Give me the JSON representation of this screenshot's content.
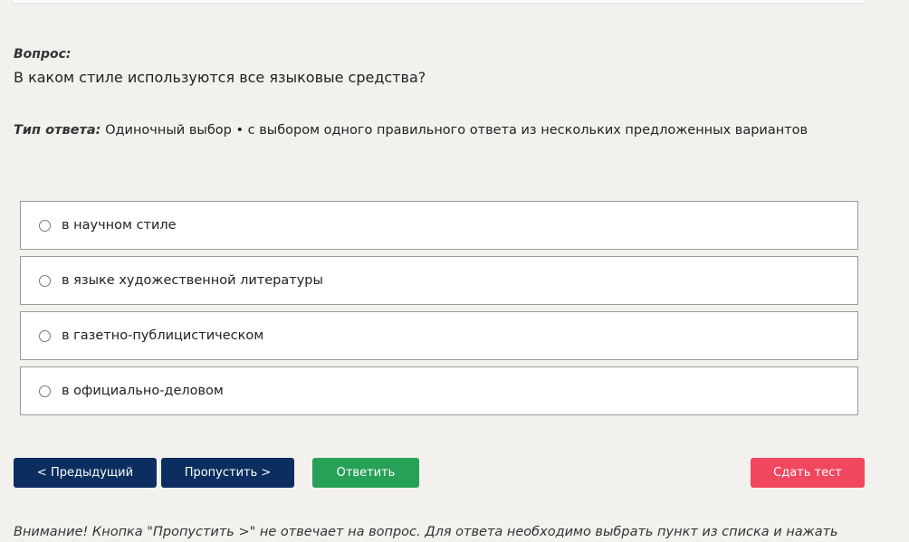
{
  "question": {
    "label": "Вопрос:",
    "text": "В каком стиле используются все языковые средства?"
  },
  "answer_type": {
    "label": "Тип ответа:",
    "value": "Одиночный выбор • с выбором одного правильного ответа из нескольких предложенных вариантов"
  },
  "options": [
    {
      "label": "в научном стиле",
      "selected": false
    },
    {
      "label": "в языке художественной литературы",
      "selected": false
    },
    {
      "label": "в газетно-публицистическом",
      "selected": false
    },
    {
      "label": "в официально-деловом",
      "selected": false
    }
  ],
  "buttons": {
    "prev": "< Предыдущий",
    "skip": "Пропустить >",
    "answer": "Ответить",
    "finish": "Сдать тест"
  },
  "colors": {
    "nav_button": "#0c2d5f",
    "answer_button": "#28a158",
    "finish_button": "#f0475e",
    "background": "#f2f1ee"
  },
  "notice": "Внимание! Кнопка \"Пропустить >\" не отвечает на вопрос. Для ответа необходимо выбрать пункт из списка и нажать"
}
